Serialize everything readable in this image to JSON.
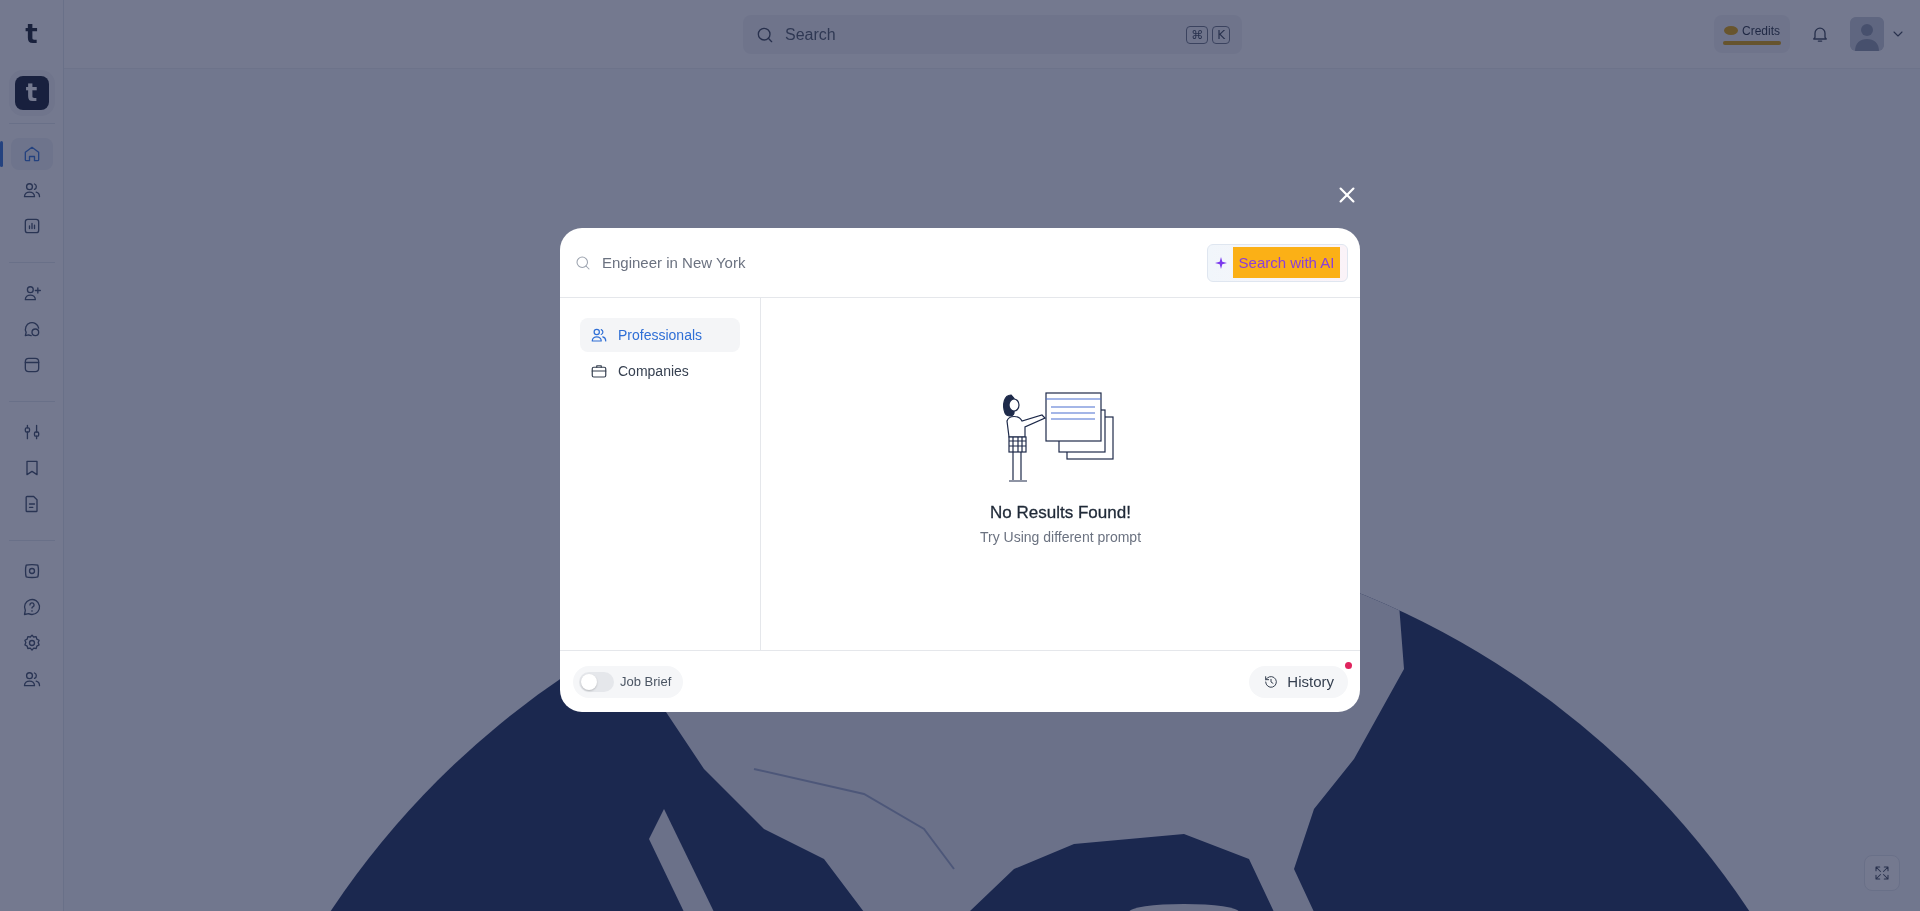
{
  "brand": {
    "letter": "t",
    "badge_letter": "t"
  },
  "sidebar": {
    "groups": [
      {
        "items": [
          {
            "selected": true
          },
          {
            "selected": false
          },
          {
            "selected": false
          }
        ]
      },
      {
        "items": [
          {
            "selected": false
          },
          {
            "selected": false
          },
          {
            "selected": false
          }
        ]
      },
      {
        "items": [
          {
            "selected": false
          },
          {
            "selected": false
          },
          {
            "selected": false
          }
        ]
      },
      {
        "items": [
          {
            "selected": false
          },
          {
            "selected": false
          },
          {
            "selected": false
          },
          {
            "selected": false
          }
        ]
      }
    ]
  },
  "header": {
    "search": {
      "placeholder": "Search",
      "keys": [
        "⌘",
        "K"
      ]
    },
    "credits": {
      "label": "Credits",
      "level": 1
    }
  },
  "modal": {
    "search": {
      "placeholder": "Engineer in New York"
    },
    "ai_button": "Search with AI",
    "categories": [
      {
        "label": "Professionals",
        "selected": true
      },
      {
        "label": "Companies",
        "selected": false
      }
    ],
    "empty_state": {
      "title": "No Results Found!",
      "message": "Try Using different prompt"
    },
    "job_brief": {
      "label": "Job Brief",
      "on": false
    },
    "history": {
      "label": "History",
      "has_notification": true
    }
  }
}
